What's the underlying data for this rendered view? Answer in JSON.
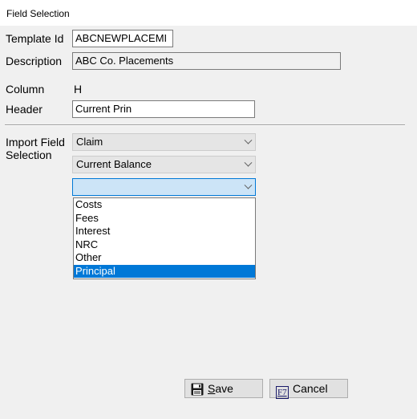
{
  "window": {
    "title": "Field Selection"
  },
  "form": {
    "template_id_label": "Template Id",
    "template_id_value": "ABCNEWPLACEMI",
    "description_label": "Description",
    "description_value": "ABC Co. Placements",
    "column_label": "Column",
    "column_value": "H",
    "header_label": "Header",
    "header_value": "Current Prin",
    "import_label_line1": "Import Field",
    "import_label_line2": "Selection",
    "combo1_value": "Claim",
    "combo2_value": "Current Balance",
    "combo3_value": ""
  },
  "dropdown": {
    "options": [
      "Costs",
      "Fees",
      "Interest",
      "NRC",
      "Other",
      "Principal"
    ],
    "selected": "Principal"
  },
  "buttons": {
    "save_label_key": "S",
    "save_label_rest": "ave",
    "cancel_key": "F7",
    "cancel_label": "Cancel"
  },
  "icons": {
    "save": "floppy-disk-icon",
    "cancel": "f7-key-icon"
  },
  "colors": {
    "selection": "#0078d7",
    "combo_focus_bg": "#cce4f7"
  }
}
